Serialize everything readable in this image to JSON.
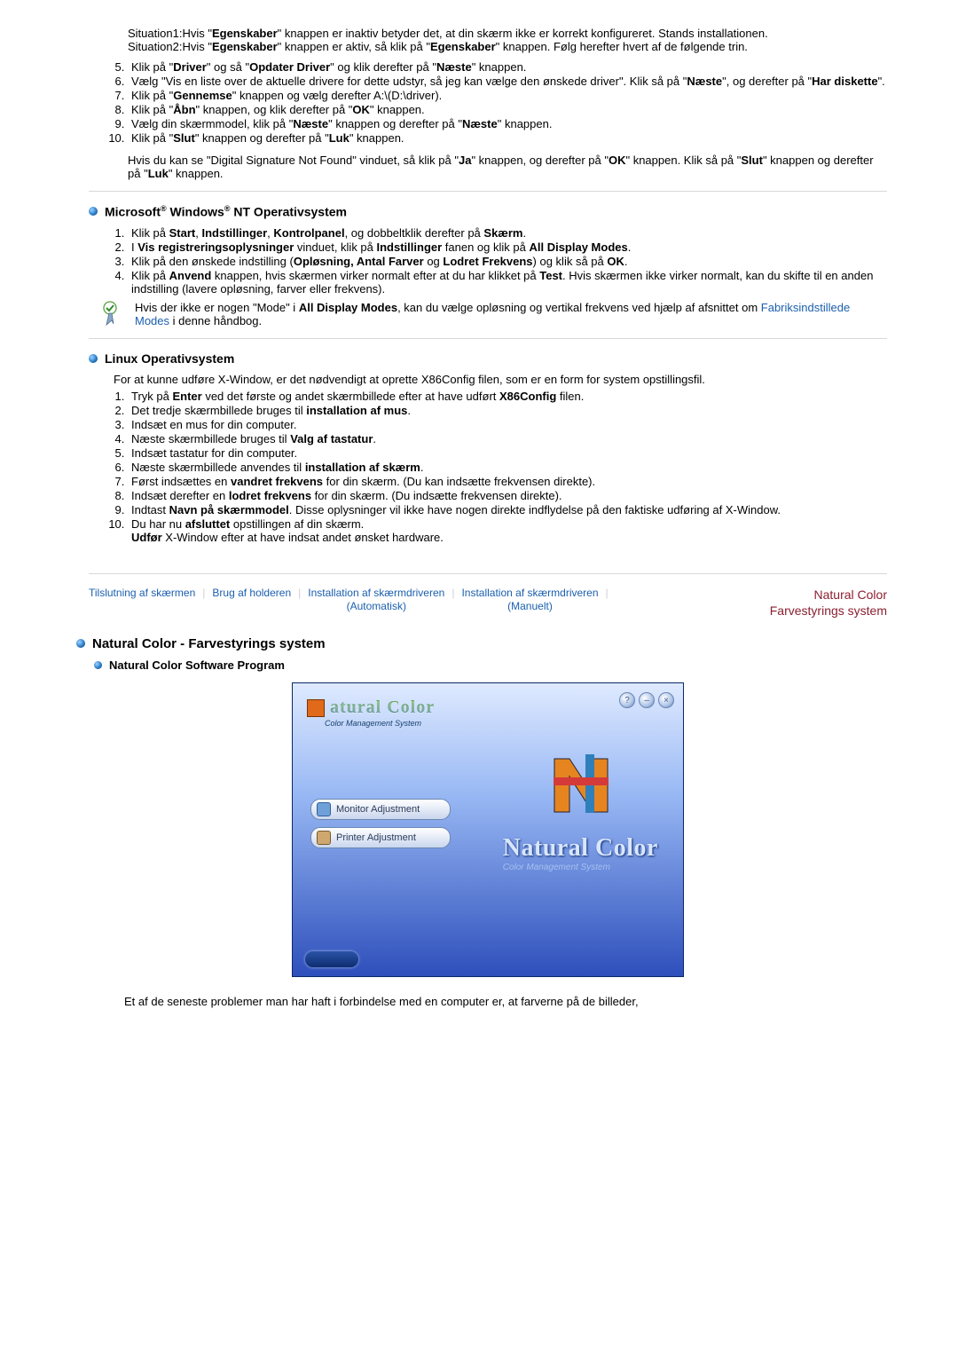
{
  "intro_situations": {
    "s1_label": "Situation1:",
    "s1_text_a": "Hvis \"",
    "s1_bold1": "Egenskaber",
    "s1_text_b": "\" knappen er inaktiv betyder det, at din skærm ikke er korrekt konfigureret. Stands installationen.",
    "s2_label": "Situation2:",
    "s2_text_a": "Hvis \"",
    "s2_bold1": "Egenskaber",
    "s2_text_b": "\" knappen er aktiv, så klik på \"",
    "s2_bold2": "Egenskaber",
    "s2_text_c": "\" knappen. Følg herefter hvert af de følgende trin."
  },
  "steps_a": [
    "Klik på \"<b>Driver</b>\" og så \"<b>Opdater Driver</b>\" og klik derefter på \"<b>Næste</b>\" knappen.",
    "Vælg \"Vis en liste over de aktuelle drivere for dette udstyr, så jeg kan vælge den ønskede driver\". Klik så på \"<b>Næste</b>\", og derefter på \"<b>Har diskette</b>\".",
    "Klik på \"<b>Gennemse</b>\" knappen og vælg derefter A:\\(D:\\driver).",
    "Klik på \"<b>Åbn</b>\" knappen, og klik derefter på \"<b>OK</b>\" knappen.",
    "Vælg din skærmmodel, klik på \"<b>Næste</b>\" knappen og derefter på \"<b>Næste</b>\" knappen.",
    "Klik på \"<b>Slut</b>\" knappen og derefter på \"<b>Luk</b>\" knappen."
  ],
  "post_a": "Hvis du kan se \"Digital Signature Not Found\" vinduet, så klik på \"<b>Ja</b>\" knappen, og derefter på \"<b>OK</b>\" knappen. Klik så på \"<b>Slut</b>\" knappen og derefter på \"<b>Luk</b>\" knappen.",
  "heading_nt_a": "Microsoft",
  "heading_nt_b": " Windows",
  "heading_nt_c": " NT Operativsystem",
  "steps_nt": [
    "Klik på <b>Start</b>, <b>Indstillinger</b>, <b>Kontrolpanel</b>, og dobbeltklik derefter på <b>Skærm</b>.",
    "I <b>Vis registreringsoplysninger</b> vinduet, klik på <b>Indstillinger</b> fanen og klik på <b>All Display Modes</b>.",
    "Klik på den ønskede indstilling (<b>Opløsning, Antal Farver</b> og <b>Lodret Frekvens</b>) og klik så på <b>OK</b>.",
    "Klik på <b>Anvend</b> knappen, hvis skærmen virker normalt efter at du har klikket på <b>Test</b>. Hvis skærmen ikke virker normalt, kan du skifte til en anden indstilling (lavere opløsning, farver eller frekvens)."
  ],
  "nt_note_a": "Hvis der ikke er nogen \"Mode\" i ",
  "nt_note_bold": "All Display Modes",
  "nt_note_b": ", kan du vælge opløsning og vertikal frekvens ved hjælp af afsnittet om ",
  "nt_note_link": "Fabriksindstillede Modes",
  "nt_note_c": " i denne håndbog.",
  "heading_linux": "Linux Operativsystem",
  "linux_intro": "For at kunne udføre X-Window, er det nødvendigt at oprette X86Config filen, som er en form for system opstillingsfil.",
  "steps_linux": [
    "Tryk på <b>Enter</b> ved det første og andet skærmbillede efter at have udført <b>X86Config</b> filen.",
    "Det tredje skærmbillede bruges til <b>installation af mus</b>.",
    "Indsæt en mus for din computer.",
    "Næste skærmbillede bruges til <b>Valg af tastatur</b>.",
    "Indsæt tastatur for din computer.",
    "Næste skærmbillede anvendes til <b>installation af skærm</b>.",
    "Først indsættes en <b>vandret frekvens</b> for din skærm. (Du kan indsætte frekvensen direkte).",
    "Indsæt derefter en <b>lodret frekvens</b> for din skærm. (Du indsætte frekvensen direkte).",
    "Indtast <b>Navn på skærmmodel</b>. Disse oplysninger vil ikke have nogen direkte indflydelse på den faktiske udføring af X-Window.",
    "Du har nu <b>afsluttet</b> opstillingen af din skærm.<br><b>Udfør</b> X-Window efter at have indsat andet ønsket hardware."
  ],
  "nav": {
    "a": "Tilslutning af skærmen",
    "b": "Brug af holderen",
    "c1": "Installation af skærmdriveren",
    "c2": "(Automatisk)",
    "d1": "Installation af skærmdriveren",
    "d2": "(Manuelt)",
    "e1": "Natural Color",
    "e2": "Farvestyrings system"
  },
  "sec_title": "Natural Color - Farvestyrings system",
  "sec_sub": "Natural Color Software Program",
  "sc": {
    "logo": "atural Color",
    "sub": "Color Management System",
    "btn1": "Monitor Adjustment",
    "btn2": "Printer Adjustment",
    "big": "Natural Color",
    "bigsub": "Color Management System"
  },
  "footer": "Et af de seneste problemer man har haft i forbindelse med en computer er, at farverne på de billeder,"
}
